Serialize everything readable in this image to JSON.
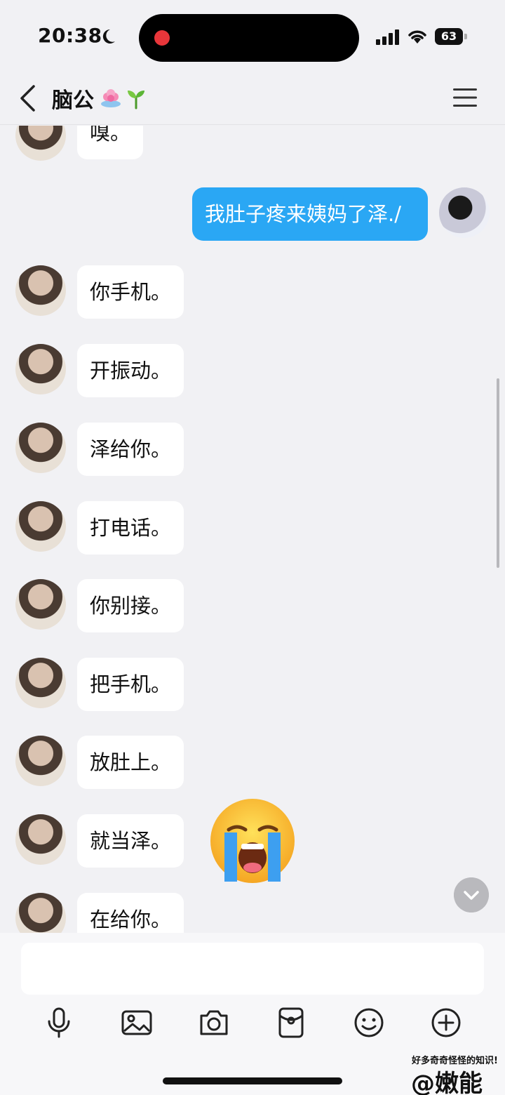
{
  "status_bar": {
    "time": "20:38",
    "battery": "63"
  },
  "header": {
    "title": "脑公"
  },
  "messages": [
    {
      "from": "him",
      "text": "嗅。"
    },
    {
      "from": "me",
      "text": "我肚子疼来姨妈了泽./"
    },
    {
      "from": "him",
      "text": "你手机。"
    },
    {
      "from": "him",
      "text": "开振动。"
    },
    {
      "from": "him",
      "text": "泽给你。"
    },
    {
      "from": "him",
      "text": "打电话。"
    },
    {
      "from": "him",
      "text": "你别接。"
    },
    {
      "from": "him",
      "text": "把手机。"
    },
    {
      "from": "him",
      "text": "放肚上。"
    },
    {
      "from": "him",
      "text": "就当泽。"
    },
    {
      "from": "him",
      "text": "在给你。"
    }
  ],
  "input": {
    "value": ""
  },
  "watermark": {
    "tagline": "好多奇奇怪怪的知识!",
    "handle": "@嫩能"
  },
  "colors": {
    "outgoing_bubble": "#2aa7f4",
    "background": "#f1f1f4",
    "record_dot": "#e8363a"
  },
  "icons": [
    "microphone-icon",
    "image-icon",
    "camera-icon",
    "red-packet-icon",
    "emoji-icon",
    "plus-icon"
  ]
}
